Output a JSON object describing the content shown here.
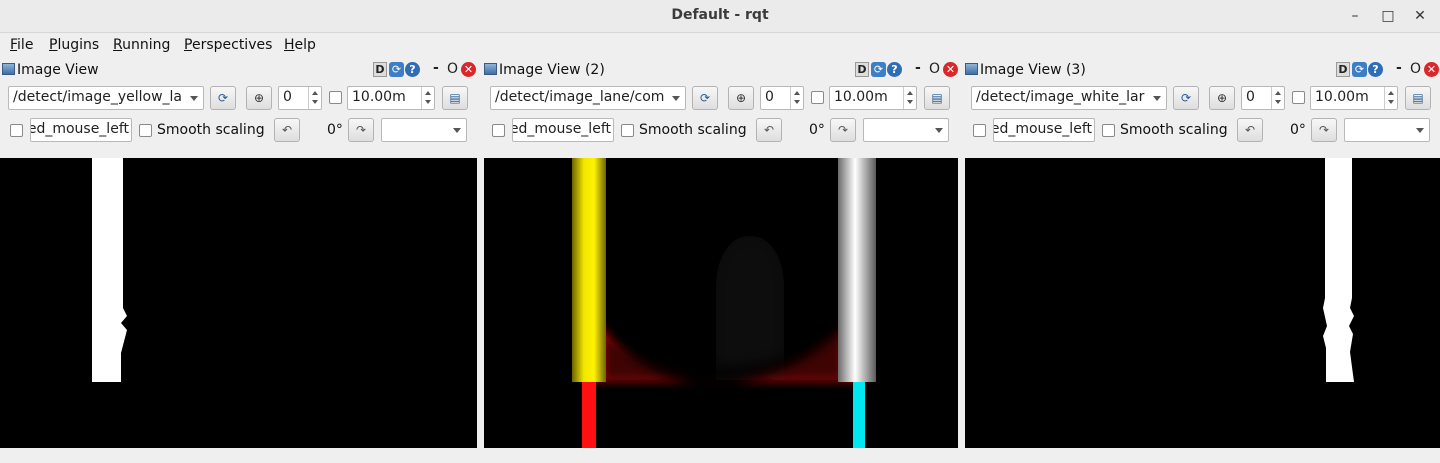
{
  "window": {
    "title": "Default - rqt",
    "minimize_glyph": "–",
    "maximize_glyph": "□",
    "close_glyph": "✕"
  },
  "menu": [
    {
      "key": "F",
      "rest": "ile"
    },
    {
      "key": "P",
      "rest": "lugins"
    },
    {
      "key": "R",
      "rest": "unning"
    },
    {
      "key": "P",
      "rest": "erspectives"
    },
    {
      "key": "H",
      "rest": "elp"
    }
  ],
  "panel_common": {
    "d_label": "D",
    "dash": "-",
    "float_label": "O",
    "topic_field": "ed_mouse_left",
    "smooth_scaling": "Smooth scaling",
    "rotation": "0°"
  },
  "panels": [
    {
      "title": "Image View",
      "topic": "/detect/image_yellow_la",
      "spin_value": "0",
      "max_value": "10.00m"
    },
    {
      "title": "Image View (2)",
      "topic": "/detect/image_lane/com",
      "spin_value": "0",
      "max_value": "10.00m"
    },
    {
      "title": "Image View (3)",
      "topic": "/detect/image_white_lar",
      "spin_value": "0",
      "max_value": "10.00m"
    }
  ],
  "colors": {
    "yellow_lane": "#f2e600",
    "white_lane": "#ffffff",
    "red_center": "#ff1010",
    "cyan_marker": "#00e8f0",
    "close_red": "#d9272b"
  }
}
